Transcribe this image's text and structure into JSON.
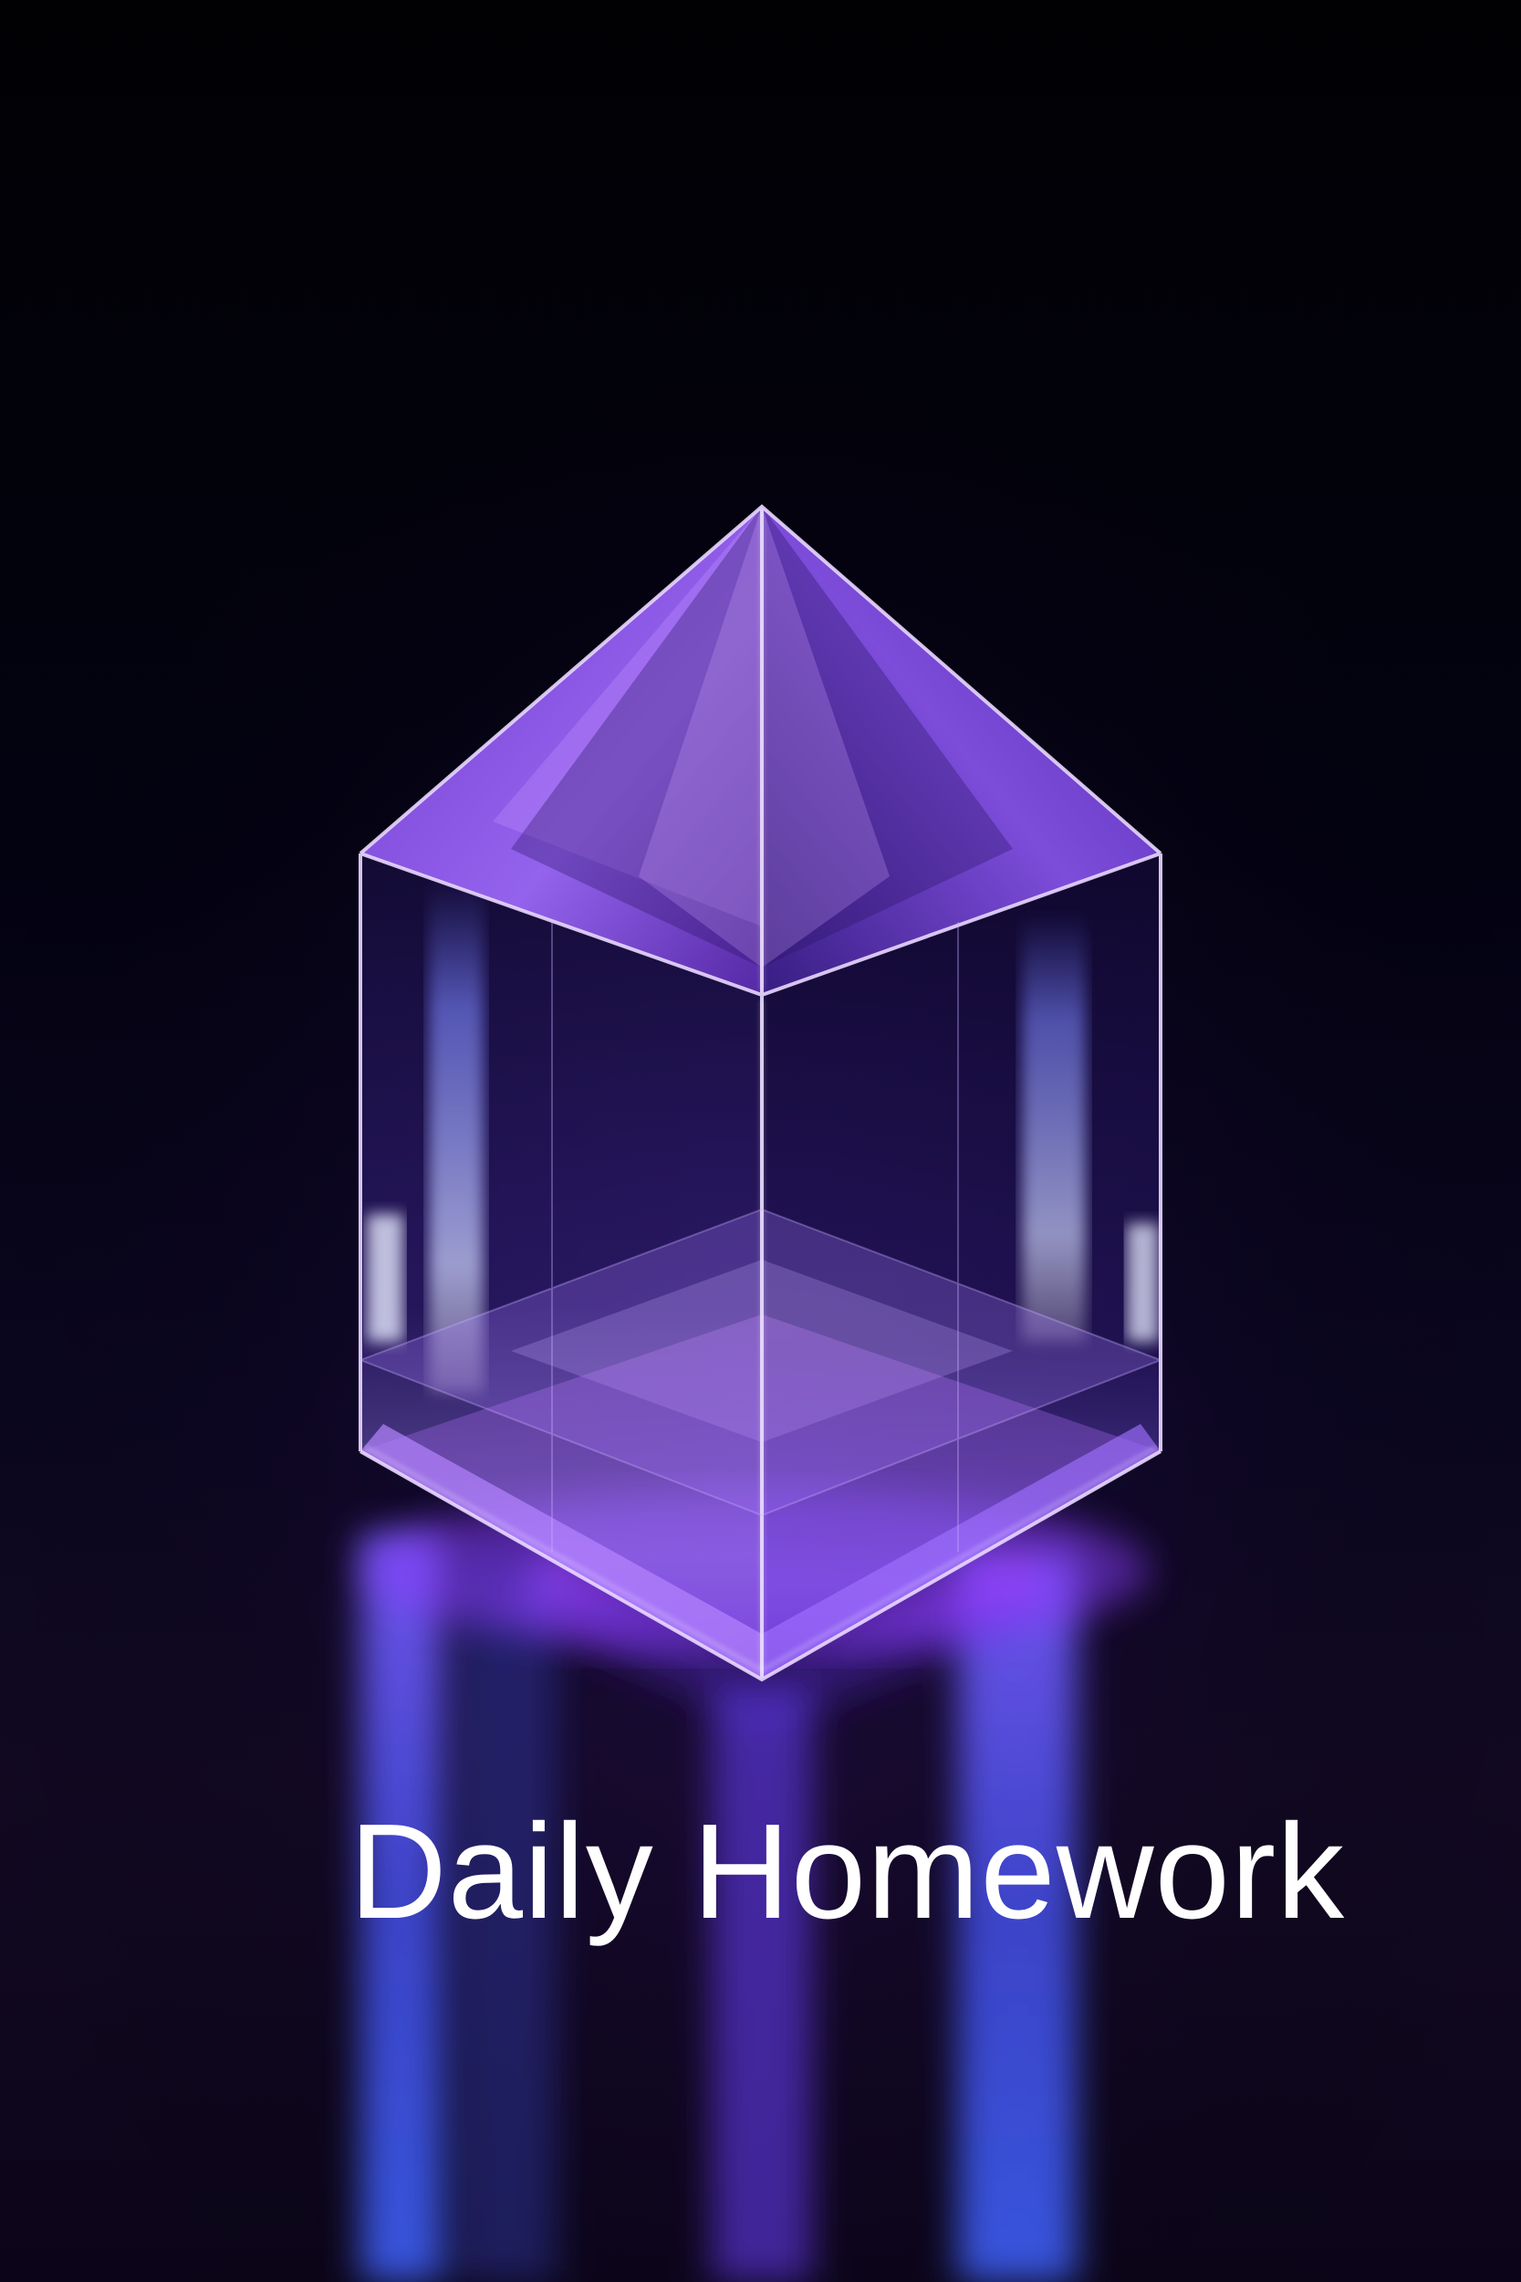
{
  "poster": {
    "title": "Daily Homework"
  },
  "artwork": {
    "subject": "glass-crystal-prism-icon",
    "colors": {
      "background": "#020108",
      "crystal_violet": "#8b4dff",
      "crystal_light": "#d9b8ff",
      "reflection_blue": "#3f5fff",
      "glow_magenta": "#b040ff"
    }
  }
}
